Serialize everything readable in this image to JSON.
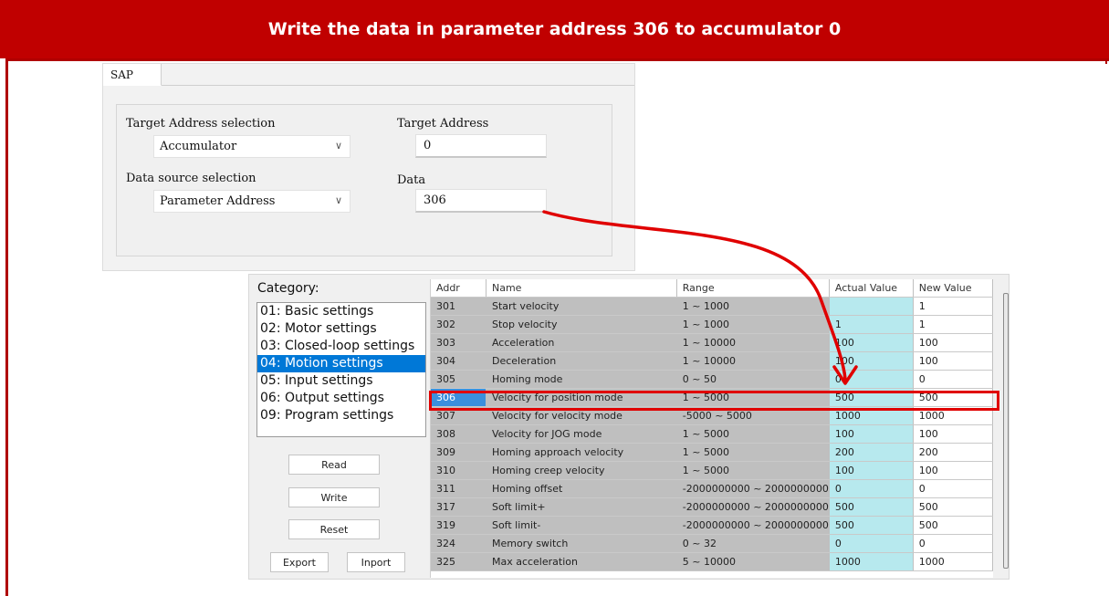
{
  "banner": {
    "title": "Write the data in parameter address 306 to accumulator 0"
  },
  "colors": {
    "banner": "#c00000",
    "highlight": "#e00000",
    "selection": "#0078d7",
    "actual_value_cell": "#b7e9ee"
  },
  "sap": {
    "tab_label": "SAP",
    "target_address_selection": {
      "label": "Target Address selection",
      "value": "Accumulator"
    },
    "target_address": {
      "label": "Target Address",
      "value": "0"
    },
    "data_source_selection": {
      "label": "Data source selection",
      "value": "Parameter Address"
    },
    "data": {
      "label": "Data",
      "value": "306"
    }
  },
  "category": {
    "title": "Category:",
    "items": [
      "01: Basic settings",
      "02: Motor settings",
      "03: Closed-loop settings",
      "04: Motion settings",
      "05: Input settings",
      "06: Output settings",
      "09: Program settings"
    ],
    "selected": "04: Motion settings"
  },
  "buttons": {
    "read": "Read",
    "write": "Write",
    "reset": "Reset",
    "export": "Export",
    "import": "Inport"
  },
  "table": {
    "columns": [
      "Addr",
      "Name",
      "Range",
      "Actual Value",
      "New Value"
    ],
    "rows": [
      [
        "301",
        "Start velocity",
        "1 ~ 1000",
        "",
        "1"
      ],
      [
        "302",
        "Stop velocity",
        "1 ~ 1000",
        "1",
        "1"
      ],
      [
        "303",
        "Acceleration",
        "1 ~ 10000",
        "100",
        "100"
      ],
      [
        "304",
        "Deceleration",
        "1 ~ 10000",
        "100",
        "100"
      ],
      [
        "305",
        "Homing mode",
        "0 ~ 50",
        "0",
        "0"
      ],
      [
        "306",
        "Velocity for position mode",
        "1 ~ 5000",
        "500",
        "500"
      ],
      [
        "307",
        "Velocity for velocity mode",
        "-5000 ~ 5000",
        "1000",
        "1000"
      ],
      [
        "308",
        "Velocity for JOG mode",
        "1 ~ 5000",
        "100",
        "100"
      ],
      [
        "309",
        "Homing approach velocity",
        "1 ~ 5000",
        "200",
        "200"
      ],
      [
        "310",
        "Homing creep velocity",
        "1 ~ 5000",
        "100",
        "100"
      ],
      [
        "311",
        "Homing offset",
        "-2000000000 ~ 2000000000",
        "0",
        "0"
      ],
      [
        "317",
        "Soft limit+",
        "-2000000000 ~ 2000000000",
        "500",
        "500"
      ],
      [
        "319",
        "Soft limit-",
        "-2000000000 ~ 2000000000",
        "500",
        "500"
      ],
      [
        "324",
        "Memory switch",
        "0 ~ 32",
        "0",
        "0"
      ],
      [
        "325",
        "Max acceleration",
        "5 ~ 10000",
        "1000",
        "1000"
      ]
    ],
    "highlighted_addr": "306"
  }
}
